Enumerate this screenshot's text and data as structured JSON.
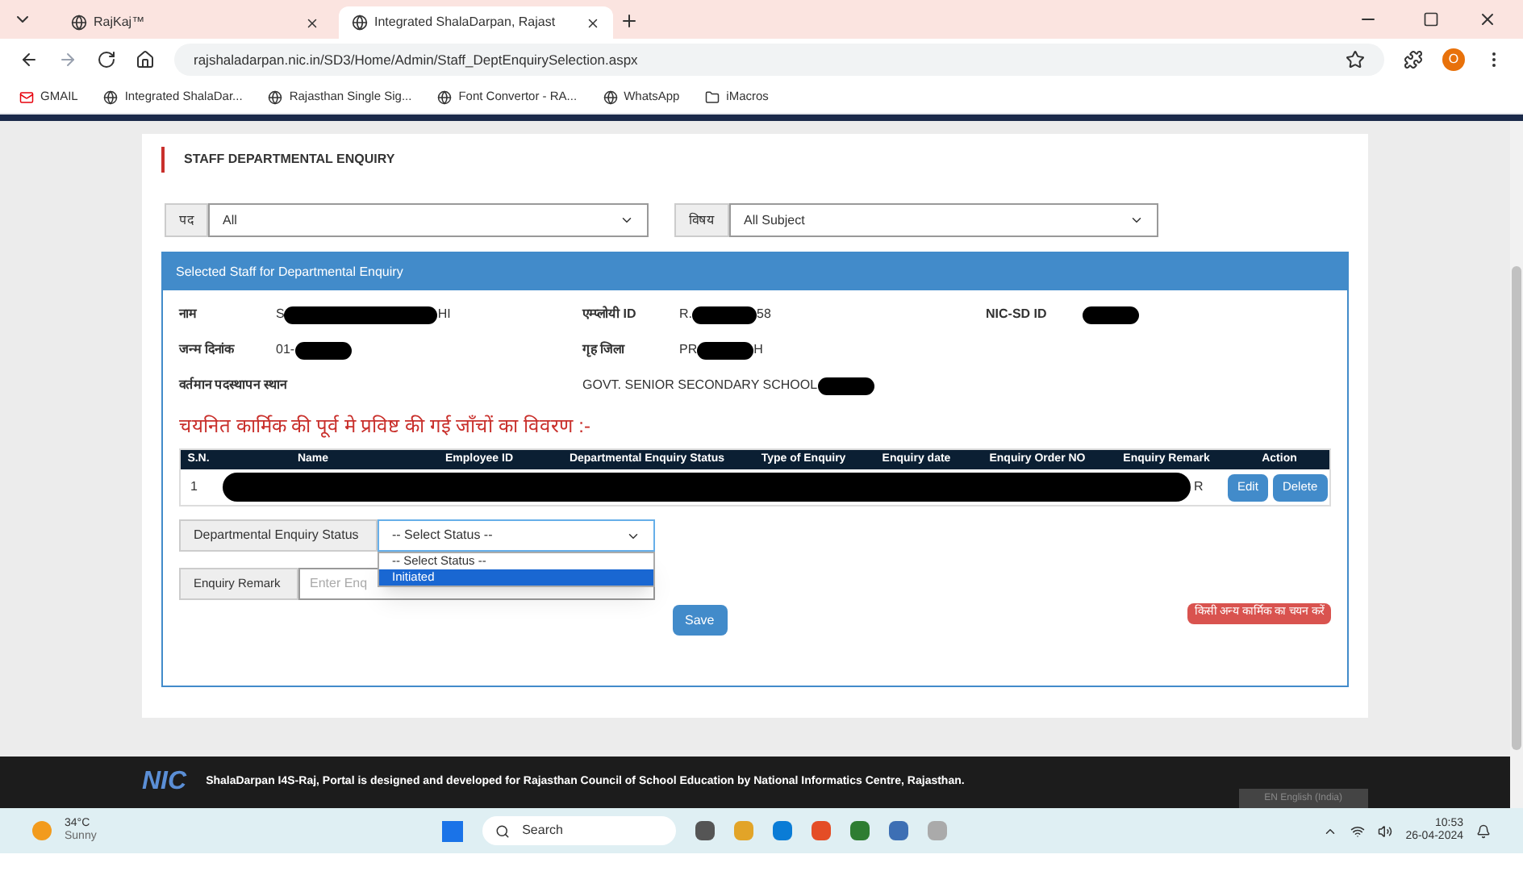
{
  "browser": {
    "tabs": [
      {
        "title": "RajKaj™",
        "selected": false
      },
      {
        "title": "Integrated ShalaDarpan, Rajast",
        "selected": true
      }
    ],
    "url": "rajshaladarpan.nic.in/SD3/Home/Admin/Staff_DeptEnquirySelection.aspx",
    "bookmarks": [
      "GMAIL",
      "Integrated ShalaDar...",
      "Rajasthan Single Sig...",
      "Font Convertor - RA...",
      "WhatsApp",
      "iMacros"
    ],
    "profile_initial": "O"
  },
  "page": {
    "title": "STAFF DEPARTMENTAL ENQUIRY",
    "filters": [
      {
        "label": "पद",
        "value": "All"
      },
      {
        "label": "विषय",
        "value": "All Subject"
      }
    ],
    "panel": {
      "title": "Selected Staff for Departmental Enquiry",
      "fields": [
        {
          "label": "नाम",
          "prefix": "S",
          "suffix": "HI"
        },
        {
          "label": "एम्प्लोयी ID",
          "prefix": "R.",
          "suffix": "58"
        },
        {
          "label": "NIC-SD ID"
        },
        {
          "label": "जन्म दिनांक",
          "prefix": "01-"
        },
        {
          "label": "गृह जिला",
          "prefix": "PR",
          "suffix": "H"
        },
        {
          "label": "वर्तमान पदस्थापन स्थान",
          "prefix": "GOVT. SENIOR SECONDARY SCHOOL"
        }
      ],
      "history_heading": "चयनित कार्मिक की पूर्व मे प्रविष्ट की गई जाँचों का विवरण :-",
      "table": {
        "columns": [
          "S.N.",
          "Name",
          "Employee ID",
          "Departmental Enquiry Status",
          "Type of Enquiry",
          "Enquiry date",
          "Enquiry Order NO",
          "Enquiry Remark",
          "Action"
        ],
        "rows": [
          {
            "sn": "1",
            "tail": "R",
            "actions": [
              "Edit",
              "Delete"
            ]
          }
        ]
      },
      "status_label": "Departmental Enquiry Status",
      "status_value": "-- Select Status --",
      "status_options": [
        {
          "label": "-- Select Status --",
          "selected": false
        },
        {
          "label": "Initiated",
          "selected": true
        }
      ],
      "remark_label": "Enquiry Remark",
      "remark_placeholder": "Enter Enq",
      "save": "Save",
      "other_staff": "किसी अन्य कार्मिक का चयन करें"
    }
  },
  "footer": {
    "logo": "NIC",
    "text": "ShalaDarpan I4S-Raj, Portal is designed and developed for Rajasthan Council of School Education by National Informatics Centre, Rajasthan.",
    "language": "EN English (India)"
  },
  "taskbar": {
    "temperature": "34°C",
    "weather": "Sunny",
    "search": "Search",
    "time": "10:53",
    "date": "26-04-2024"
  }
}
